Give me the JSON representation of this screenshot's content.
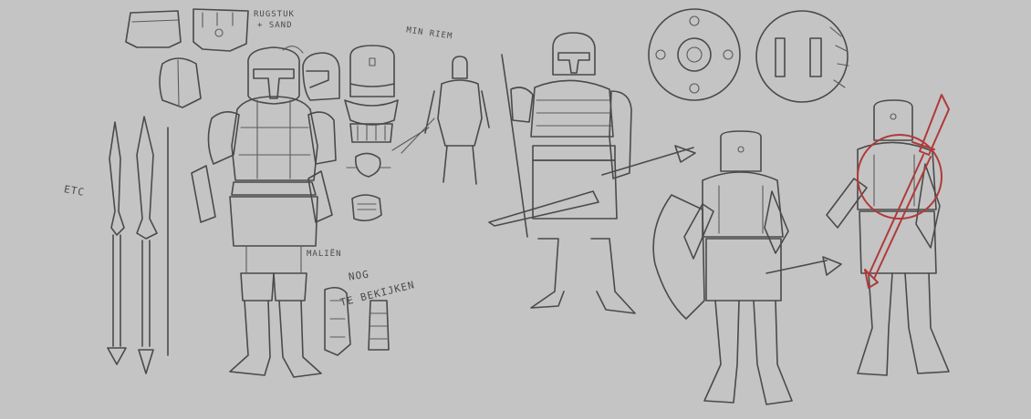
{
  "notes": {
    "rugstuk_line1": "RUGSTUK",
    "rugstuk_line2": "+ SAND",
    "riem": "MIN RIEM",
    "etc": "ETC",
    "malien": "MALIËN",
    "nog_line1": "NOG",
    "nog_line2": "TE BEKIJKEN"
  },
  "colors": {
    "background": "#c4c4c4",
    "ink": "#4a4a4a",
    "overlay_red": "#b03a3a"
  }
}
